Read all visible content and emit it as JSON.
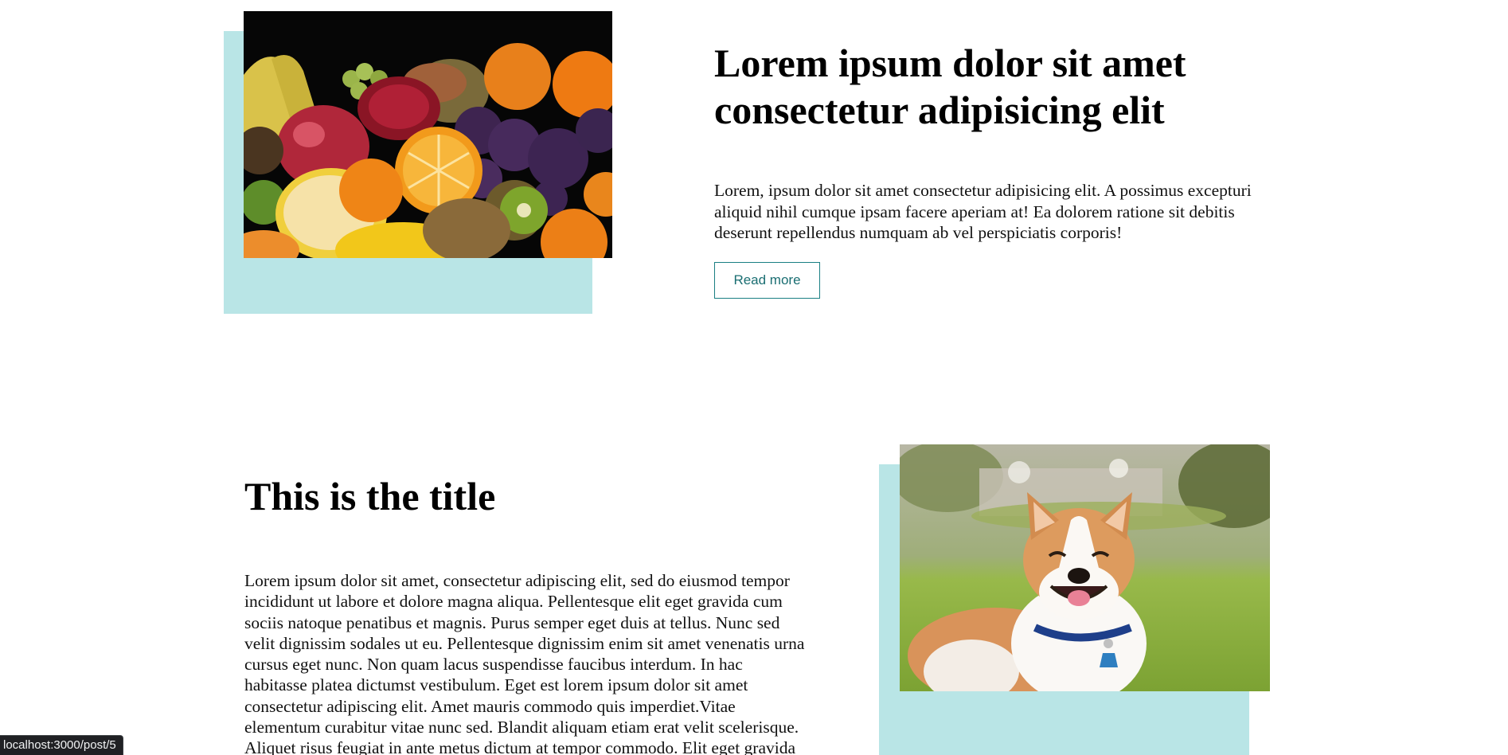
{
  "posts": [
    {
      "title": "Lorem ipsum dolor sit amet consectetur adipisicing elit",
      "body": "Lorem, ipsum dolor sit amet consectetur adipisicing elit. A possimus excepturi aliquid nihil cumque ipsam facere aperiam at! Ea dolorem ratione sit debitis deserunt repellendus numquam ab vel perspiciatis corporis!",
      "button_label": "Read more",
      "image": "fruit-assortment-photo"
    },
    {
      "title": "This is the title",
      "body": "Lorem ipsum dolor sit amet, consectetur adipiscing elit, sed do eiusmod tempor incididunt ut labore et dolore magna aliqua. Pellentesque elit eget gravida cum sociis natoque penatibus et magnis. Purus semper eget duis at tellus. Nunc sed velit dignissim sodales ut eu. Pellentesque dignissim enim sit amet venenatis urna cursus eget nunc. Non quam lacus suspendisse faucibus interdum. In hac habitasse platea dictumst vestibulum. Eget est lorem ipsum dolor sit amet consectetur adipiscing elit. Amet mauris commodo quis imperdiet.Vitae elementum curabitur vitae nunc sed. Blandit aliquam etiam erat velit scelerisque. Aliquet risus feugiat in ante metus dictum at tempor commodo. Elit eget gravida cum sociis natoque. Feugiat in",
      "image": "corgi-dog-photo"
    }
  ],
  "status_bar": {
    "url": "localhost:3000/post/5"
  },
  "colors": {
    "accent_block": "#b9e5e6",
    "button_border": "#1a7f83"
  }
}
